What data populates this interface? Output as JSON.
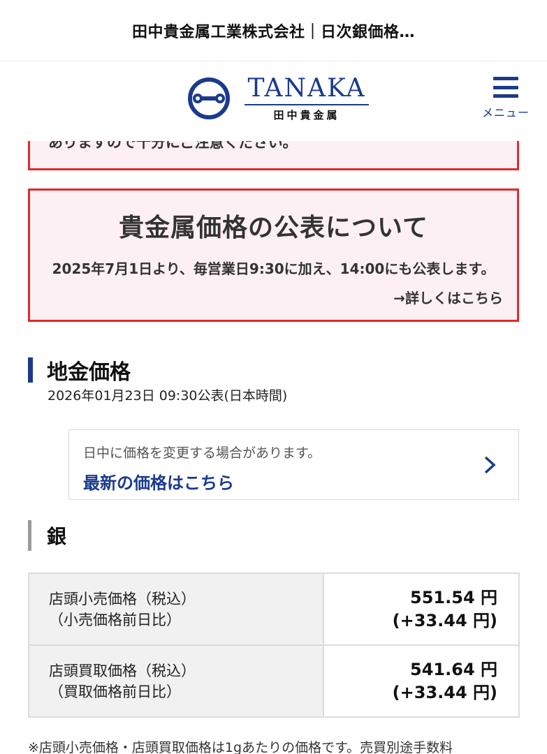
{
  "page_title": "田中貴金属工業株式会社｜日次銀価格…",
  "header": {
    "logo_en": "TANAKA",
    "logo_jp": "田中貴金属",
    "menu_label": "メニュー",
    "brand_color": "#1a3a8c"
  },
  "notice_prev": {
    "text": "ありますので十分にご注意ください。"
  },
  "notice": {
    "title": "貴金属価格の公表について",
    "body": "2025年7月1日より、毎営業日9:30に加え、14:00にも公表します。",
    "link": "→詳しくはこちら",
    "border_color": "#e02a2a",
    "bg_color": "#fdf0f5"
  },
  "section": {
    "title": "地金価格",
    "published": "2026年01月23日 09:30公表(日本時間)"
  },
  "latest": {
    "note": "日中に価格を変更する場合があります。",
    "link": "最新の価格はこちら"
  },
  "metal": {
    "title": "銀",
    "rows": [
      {
        "label_line1": "店頭小売価格（税込）",
        "label_line2": "（小売価格前日比）",
        "price": "551.54 円",
        "change": "(+33.44 円)"
      },
      {
        "label_line1": "店頭買取価格（税込）",
        "label_line2": "（買取価格前日比）",
        "price": "541.64 円",
        "change": "(+33.44 円)"
      }
    ]
  },
  "footnote": "※店頭小売価格・店頭買取価格は1gあたりの価格です。売買別途手数料"
}
